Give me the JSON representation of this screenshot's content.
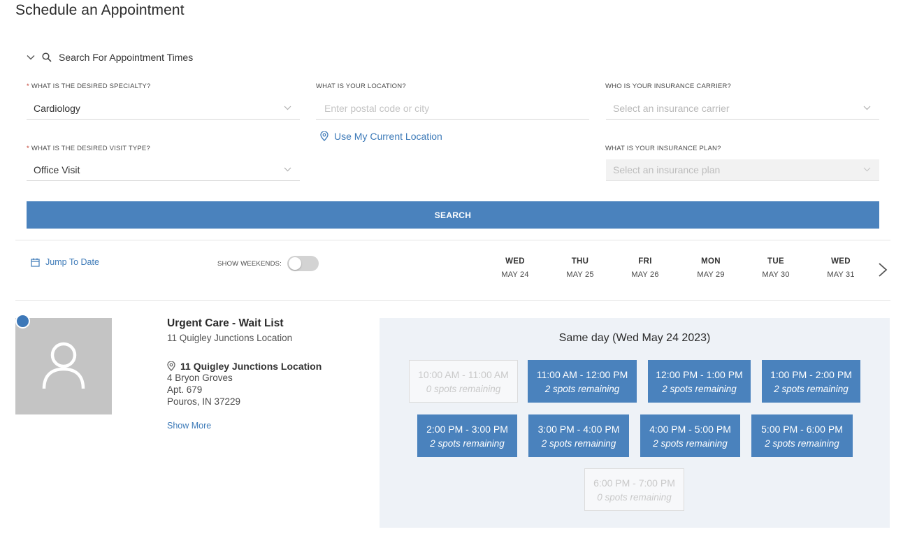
{
  "page": {
    "title": "Schedule an Appointment"
  },
  "search_section": {
    "toggle_label": "Search For Appointment Times"
  },
  "form": {
    "specialty": {
      "label": "WHAT IS THE DESIRED SPECIALTY?",
      "required": true,
      "value": "Cardiology"
    },
    "visit_type": {
      "label": "WHAT IS THE DESIRED VISIT TYPE?",
      "required": true,
      "value": "Office Visit"
    },
    "location": {
      "label": "WHAT IS YOUR LOCATION?",
      "placeholder": "Enter postal code or city",
      "value": "",
      "use_current_label": "Use My Current Location"
    },
    "carrier": {
      "label": "WHO IS YOUR INSURANCE CARRIER?",
      "placeholder": "Select an insurance carrier"
    },
    "plan": {
      "label": "WHAT IS YOUR INSURANCE PLAN?",
      "placeholder": "Select an insurance plan",
      "disabled": true
    },
    "required_marker": "*",
    "search_button": "SEARCH"
  },
  "calendar_bar": {
    "jump_label": "Jump To Date",
    "weekends_label": "SHOW WEEKENDS:",
    "weekends_on": false,
    "days": [
      {
        "dow": "WED",
        "date": "MAY 24"
      },
      {
        "dow": "THU",
        "date": "MAY 25"
      },
      {
        "dow": "FRI",
        "date": "MAY 26"
      },
      {
        "dow": "MON",
        "date": "MAY 29"
      },
      {
        "dow": "TUE",
        "date": "MAY 30"
      },
      {
        "dow": "WED",
        "date": "MAY 31"
      }
    ]
  },
  "provider": {
    "name": "Urgent Care - Wait List",
    "location_name": "11 Quigley Junctions Location",
    "address_title": "11 Quigley Junctions Location",
    "address_lines": [
      "4 Bryon Groves",
      "Apt. 679",
      "Pouros, IN 37229"
    ],
    "show_more": "Show More"
  },
  "slots": {
    "heading": "Same day (Wed May 24 2023)",
    "items": [
      {
        "time": "10:00 AM - 11:00 AM",
        "spots": "0 spots remaining",
        "available": false
      },
      {
        "time": "11:00 AM - 12:00 PM",
        "spots": "2 spots remaining",
        "available": true
      },
      {
        "time": "12:00 PM - 1:00 PM",
        "spots": "2 spots remaining",
        "available": true
      },
      {
        "time": "1:00 PM - 2:00 PM",
        "spots": "2 spots remaining",
        "available": true
      },
      {
        "time": "2:00 PM - 3:00 PM",
        "spots": "2 spots remaining",
        "available": true
      },
      {
        "time": "3:00 PM - 4:00 PM",
        "spots": "2 spots remaining",
        "available": true
      },
      {
        "time": "4:00 PM - 5:00 PM",
        "spots": "2 spots remaining",
        "available": true
      },
      {
        "time": "5:00 PM - 6:00 PM",
        "spots": "2 spots remaining",
        "available": true
      },
      {
        "time": "6:00 PM - 7:00 PM",
        "spots": "0 spots remaining",
        "available": false
      }
    ]
  },
  "colors": {
    "accent": "#4a82bd",
    "link": "#3d7ab8",
    "required": "#c0392b",
    "slot_panel_bg": "#eef2f7",
    "photo_placeholder": "#c4c4c4"
  },
  "icons": {
    "toggle": "chevron-down-icon",
    "search": "search-icon",
    "location": "location-pin-icon",
    "calendar": "calendar-icon",
    "next": "chevron-right-icon",
    "avatar": "user-avatar-icon"
  }
}
